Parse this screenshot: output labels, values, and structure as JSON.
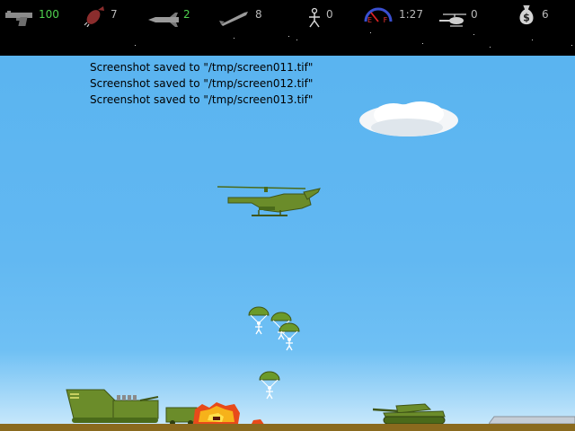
{
  "hud": {
    "health": "100",
    "bombs": "7",
    "missiles": "2",
    "rockets": "8",
    "soldiers": "0",
    "fuel_gauge_letters": "E F",
    "time": "1:27",
    "helicopters": "0",
    "money": "6",
    "icons": [
      "pistol-icon",
      "bomb-icon",
      "missile-icon",
      "rocket-icon",
      "soldier-icon",
      "fuel-gauge-icon",
      "helicopter-icon",
      "money-bag-icon"
    ]
  },
  "messages": [
    "Screenshot saved to \"/tmp/screen011.tif\"",
    "Screenshot saved to \"/tmp/screen012.tif\"",
    "Screenshot saved to \"/tmp/screen013.tif\""
  ],
  "colors": {
    "sky": "#62b8f2",
    "hud_background": "#000000",
    "hud_value_green": "#4fd24f",
    "hud_value_gray": "#b9b9b9",
    "vehicle_olive": "#6b8c2a",
    "ground": "#8a6a1e"
  }
}
